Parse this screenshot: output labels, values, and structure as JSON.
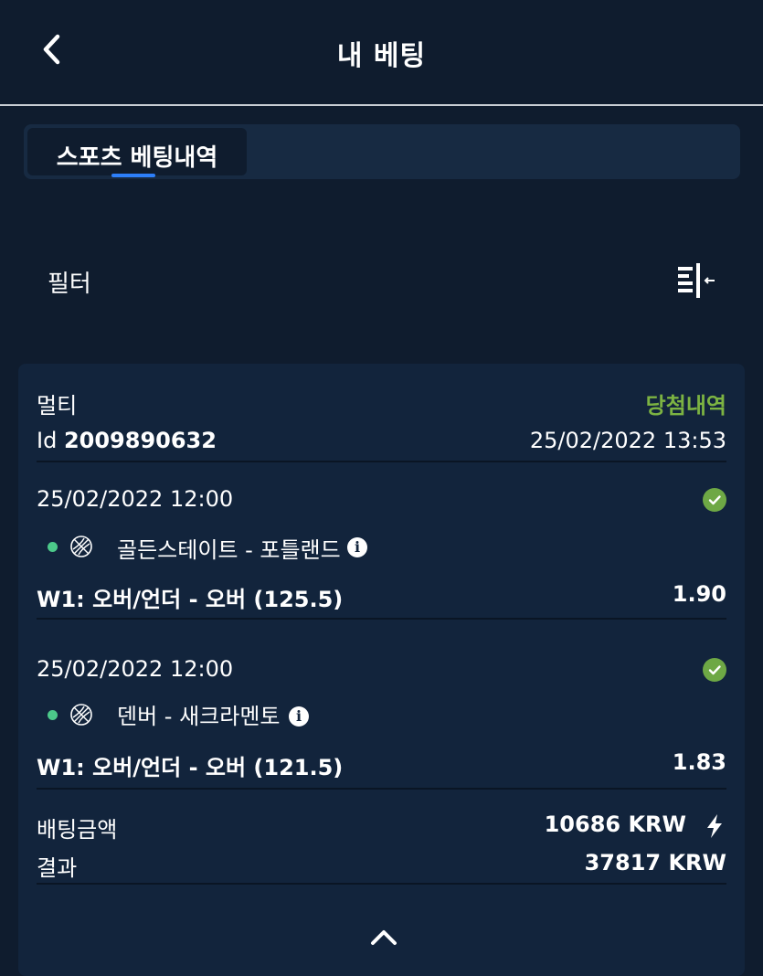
{
  "header": {
    "title": "내 베팅",
    "back_icon": "chevron-left-icon"
  },
  "tabs": [
    {
      "label": "스포츠 베팅내역",
      "active": true
    }
  ],
  "filter": {
    "label": "필터",
    "icon": "filter-collapse-icon"
  },
  "bet": {
    "type": "멀티",
    "status": "당첨내역",
    "id_prefix": "Id",
    "id": "2009890632",
    "datetime": "25/02/2022 13:53",
    "selections": [
      {
        "datetime": "25/02/2022 12:00",
        "match": "골든스테이트 - 포틀랜드",
        "market": "W1: 오버/언더 - 오버 (125.5)",
        "odds": "1.90",
        "sport_icon": "basketball-icon",
        "status_icon": "check-circle-icon"
      },
      {
        "datetime": "25/02/2022 12:00",
        "match": "덴버 - 새크라멘토",
        "market": "W1: 오버/언더 - 오버 (121.5)",
        "odds": "1.83",
        "sport_icon": "basketball-icon",
        "status_icon": "check-circle-icon"
      }
    ],
    "stake_label": "배팅금액",
    "stake": "10686 KRW",
    "result_label": "결과",
    "result": "37817 KRW"
  },
  "colors": {
    "background": "#0f1c2e",
    "card": "#12243c",
    "win_green": "#7cb342",
    "live_dot": "#4cc98a",
    "tab_accent": "#2d7ff9"
  }
}
